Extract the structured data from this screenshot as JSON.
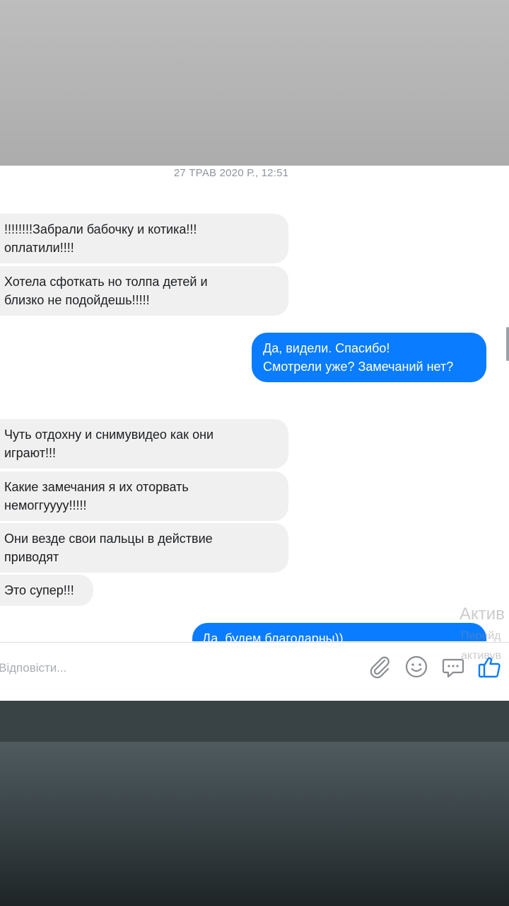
{
  "conversation": {
    "timestamp": "27 ТРАВ 2020 Р., 12:51",
    "messages": [
      {
        "direction": "incoming",
        "text": "!!!!!!!!Забрали бабочку и котика!!!\nоплатили!!!!"
      },
      {
        "direction": "incoming",
        "text": "Хотела сфоткать но толпа детей и\nблизко не подойдешь!!!!!"
      },
      {
        "direction": "outgoing",
        "text": "Да, видели. Спасибо!\nСмотрели уже? Замечаний нет?"
      },
      {
        "direction": "incoming",
        "text": "Чуть отдохну и снимувидео как они\nиграют!!!"
      },
      {
        "direction": "incoming",
        "text": "Какие замечания я их оторвать\nнемоггуууу!!!!!"
      },
      {
        "direction": "incoming",
        "text": "Они везде свои пальцы в действие\nприводят"
      },
      {
        "direction": "incoming",
        "text": "Это супер!!!"
      },
      {
        "direction": "outgoing",
        "text": "Да, будем благодарны))"
      }
    ]
  },
  "composer": {
    "placeholder": "Відповісти...",
    "icons": [
      "paperclip-icon",
      "emoji-icon",
      "chat-bubble-icon",
      "thumbs-up-icon"
    ],
    "accent_color": "#0a7cff"
  },
  "watermark": {
    "line1": "Актив",
    "line2": "Перейд",
    "line3": "активув"
  }
}
